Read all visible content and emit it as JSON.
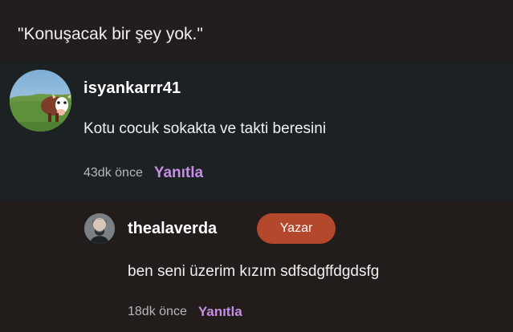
{
  "header": {
    "quote": "\"Konuşacak bir şey yok.\""
  },
  "comment": {
    "username": "isyankarrr41",
    "text": "Kotu cocuk sokakta ve takti beresini",
    "time": "43dk önce",
    "reply_label": "Yanıtla",
    "avatar_icon": "cow-photo-icon"
  },
  "reply": {
    "username": "thealaverda",
    "badge": "Yazar",
    "text": "ben seni üzerim kızım sdfsdgffdgdsfg",
    "time": "18dk önce",
    "reply_label": "Yanıtla",
    "avatar_icon": "profile-photo-icon"
  },
  "colors": {
    "accent": "#c78ce6",
    "badge": "#b4482d",
    "background_main": "#1c2123",
    "background_reply": "#221d1b"
  }
}
